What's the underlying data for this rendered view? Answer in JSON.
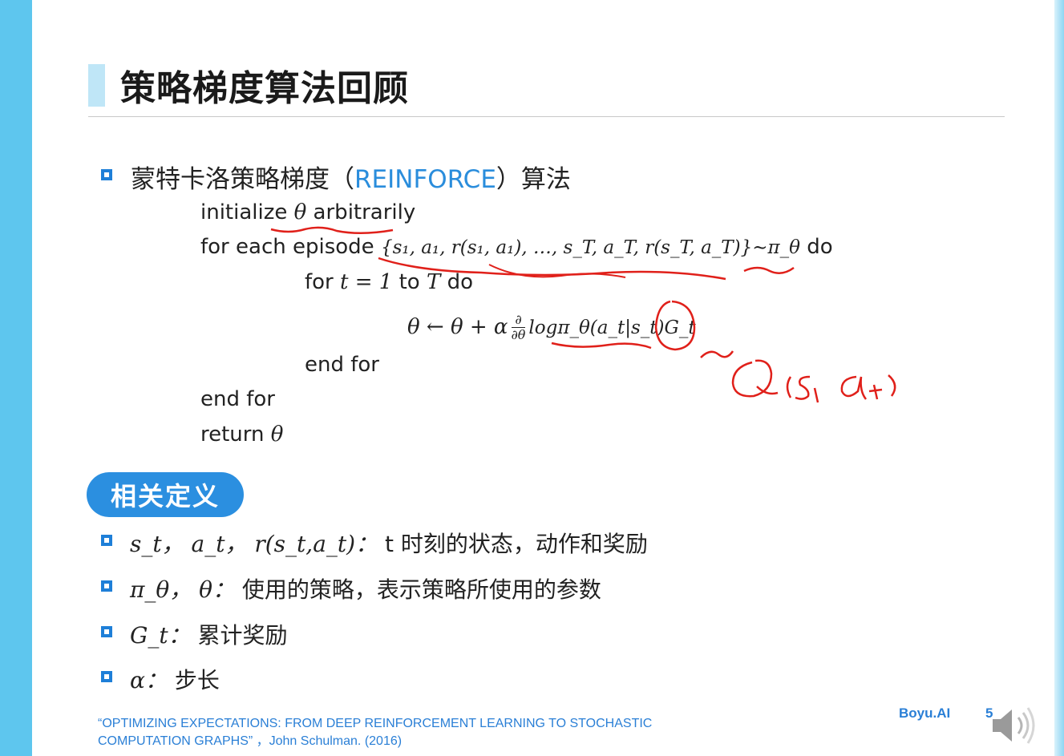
{
  "slide": {
    "title": "策略梯度算法回顾",
    "heading_prefix": "蒙特卡洛策略梯度（",
    "heading_keyword": "REINFORCE",
    "heading_suffix": "）算法",
    "algorithm": {
      "line1_text_a": "initialize ",
      "line1_theta": "θ",
      "line1_text_b": " arbitrarily",
      "line2_text": "for each episode ",
      "line2_math": "{s₁, a₁, r(s₁, a₁), …, s_T, a_T, r(s_T, a_T)}∼π_θ",
      "line2_do": " do",
      "line3_for": "for ",
      "line3_math": "t = 1",
      "line3_to": " to ",
      "line3_T": "T",
      "line3_do": " do",
      "update_lhs": "θ ← θ + α",
      "frac_num": "∂",
      "frac_den": "∂θ",
      "update_rhs": "logπ_θ(a_t|s_t)G_t",
      "end_for_inner": "end for",
      "end_for_outer": "end for",
      "return_text": "return ",
      "return_theta": "θ"
    },
    "definitions_label": "相关定义",
    "definitions": [
      {
        "math": "s_t，  a_t，  r(s_t,a_t)：",
        "text": " t 时刻的状态，动作和奖励"
      },
      {
        "math": "π_θ，  θ：",
        "text": " 使用的策略，表示策略所使用的参数"
      },
      {
        "math": "G_t：",
        "text": " 累计奖励"
      },
      {
        "math": "α：",
        "text": " 步长"
      }
    ],
    "footnote_line1": "“OPTIMIZING EXPECTATIONS: FROM DEEP REINFORCEMENT LEARNING TO STOCHASTIC",
    "footnote_line2": "COMPUTATION GRAPHS” ，John Schulman. (2016)",
    "brand": "Boyu.AI",
    "page_number": "5",
    "handwritten_annotation": "∼Q(s_t a_t)"
  },
  "colors": {
    "accent_blue": "#2b8fe0",
    "side_band": "#5ec6ee",
    "ink_red": "#e0201a"
  }
}
